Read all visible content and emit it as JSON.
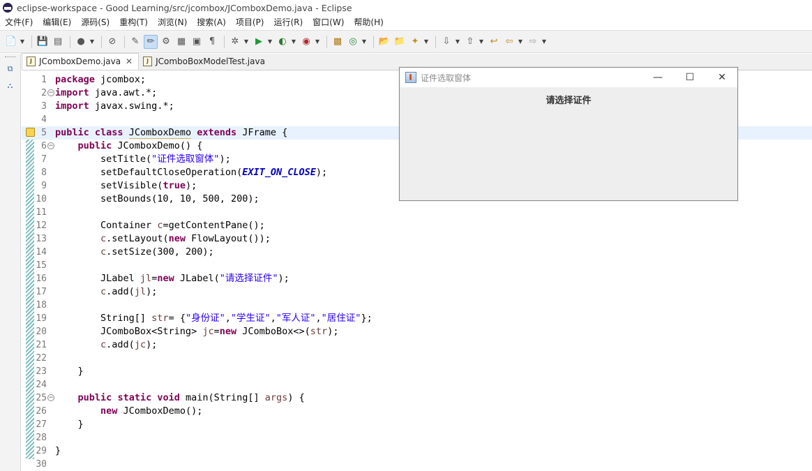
{
  "window": {
    "title": "eclipse-workspace - Good Learning/src/jcombox/JComboxDemo.java - Eclipse"
  },
  "menu": [
    "文件(F)",
    "编辑(E)",
    "源码(S)",
    "重构(T)",
    "浏览(N)",
    "搜索(A)",
    "项目(P)",
    "运行(R)",
    "窗口(W)",
    "帮助(H)"
  ],
  "toolbar": {
    "icons": [
      "new-icon",
      "save-icon",
      "save-all-icon",
      "profile-icon",
      "skip-breakpoints-icon",
      "open-type-icon",
      "toggle-mark-occurrences-icon",
      "java-browsing-icon",
      "task-icon",
      "open-resource-icon",
      "show-whitespace-icon",
      "debug-icon",
      "run-icon",
      "coverage-icon",
      "external-tools-icon",
      "new-java-project-icon",
      "new-package-icon",
      "new-class-icon",
      "open-folder-icon",
      "search-icon",
      "next-annotation-icon",
      "previous-annotation-icon",
      "last-edit-icon",
      "back-icon",
      "forward-icon"
    ]
  },
  "tabs": [
    {
      "label": "JComboxDemo.java",
      "active": true
    },
    {
      "label": "JComboBoxModelTest.java",
      "active": false
    }
  ],
  "editor": {
    "lines": [
      {
        "n": "1",
        "code": "package jcombox;"
      },
      {
        "n": "2",
        "code": "import java.awt.*;"
      },
      {
        "n": "3",
        "code": "import javax.swing.*;"
      },
      {
        "n": "4",
        "code": ""
      },
      {
        "n": "5",
        "code": "public class JComboxDemo extends JFrame {"
      },
      {
        "n": "6",
        "code": "    public JComboxDemo() {"
      },
      {
        "n": "7",
        "code": "        setTitle(\"证件选取窗体\");"
      },
      {
        "n": "8",
        "code": "        setDefaultCloseOperation(EXIT_ON_CLOSE);"
      },
      {
        "n": "9",
        "code": "        setVisible(true);"
      },
      {
        "n": "10",
        "code": "        setBounds(10, 10, 500, 200);"
      },
      {
        "n": "11",
        "code": ""
      },
      {
        "n": "12",
        "code": "        Container c=getContentPane();"
      },
      {
        "n": "13",
        "code": "        c.setLayout(new FlowLayout());"
      },
      {
        "n": "14",
        "code": "        c.setSize(300, 200);"
      },
      {
        "n": "15",
        "code": ""
      },
      {
        "n": "16",
        "code": "        JLabel jl=new JLabel(\"请选择证件\");"
      },
      {
        "n": "17",
        "code": "        c.add(jl);"
      },
      {
        "n": "18",
        "code": ""
      },
      {
        "n": "19",
        "code": "        String[] str= {\"身份证\",\"学生证\",\"军人证\",\"居住证\"};"
      },
      {
        "n": "20",
        "code": "        JComboBox<String> jc=new JComboBox<>(str);"
      },
      {
        "n": "21",
        "code": "        c.add(jc);"
      },
      {
        "n": "22",
        "code": ""
      },
      {
        "n": "23",
        "code": "    }"
      },
      {
        "n": "24",
        "code": ""
      },
      {
        "n": "25",
        "code": "    public static void main(String[] args) {"
      },
      {
        "n": "26",
        "code": "        new JComboxDemo();"
      },
      {
        "n": "27",
        "code": "    }"
      },
      {
        "n": "28",
        "code": ""
      },
      {
        "n": "29",
        "code": "}"
      },
      {
        "n": "30",
        "code": ""
      }
    ]
  },
  "jframe": {
    "title": "证件选取窗体",
    "label": "请选择证件",
    "minimize_glyph": "—",
    "maximize_glyph": "☐",
    "close_glyph": "✕"
  }
}
